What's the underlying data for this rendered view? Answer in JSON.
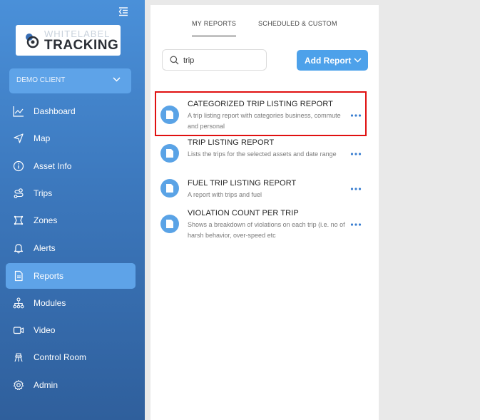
{
  "sidebar": {
    "logo": {
      "line1": "WHITELABEL",
      "line2": "TRACKING"
    },
    "client": {
      "label": "DEMO CLIENT",
      "icon": "chevron-down-icon"
    },
    "items": [
      {
        "label": "Dashboard",
        "icon": "dashboard-chart-icon",
        "active": false
      },
      {
        "label": "Map",
        "icon": "navigation-arrow-icon",
        "active": false
      },
      {
        "label": "Asset Info",
        "icon": "info-circle-icon",
        "active": false
      },
      {
        "label": "Trips",
        "icon": "route-icon",
        "active": false
      },
      {
        "label": "Zones",
        "icon": "zones-icon",
        "active": false
      },
      {
        "label": "Alerts",
        "icon": "bell-icon",
        "active": false
      },
      {
        "label": "Reports",
        "icon": "document-icon",
        "active": true
      },
      {
        "label": "Modules",
        "icon": "modules-tree-icon",
        "active": false
      },
      {
        "label": "Video",
        "icon": "video-camera-icon",
        "active": false
      },
      {
        "label": "Control Room",
        "icon": "control-room-icon",
        "active": false
      },
      {
        "label": "Admin",
        "icon": "gear-icon",
        "active": false
      }
    ]
  },
  "tabs": [
    {
      "label": "MY REPORTS",
      "active": true
    },
    {
      "label": "SCHEDULED & CUSTOM",
      "active": false
    }
  ],
  "search": {
    "value": "trip",
    "icon": "search-icon"
  },
  "add_report": {
    "label": "Add Report",
    "icon": "chevron-down-icon"
  },
  "reports": [
    {
      "title": "CATEGORIZED TRIP LISTING REPORT",
      "desc": "A trip listing report with categories business, commute and personal",
      "highlighted": true
    },
    {
      "title": "TRIP LISTING REPORT",
      "desc": "Lists the trips for the selected assets and date range",
      "highlighted": false
    },
    {
      "title": "FUEL TRIP LISTING REPORT",
      "desc": "A report with trips and fuel",
      "highlighted": false
    },
    {
      "title": "VIOLATION COUNT PER TRIP",
      "desc": "Shows a breakdown of violations on each trip (i.e. no of harsh behavior, over-speed etc",
      "highlighted": false
    }
  ],
  "colors": {
    "accent": "#4da1ea",
    "sidebar_top": "#4a90d9",
    "sidebar_bottom": "#2f5f9c",
    "highlight": "#e01010"
  }
}
